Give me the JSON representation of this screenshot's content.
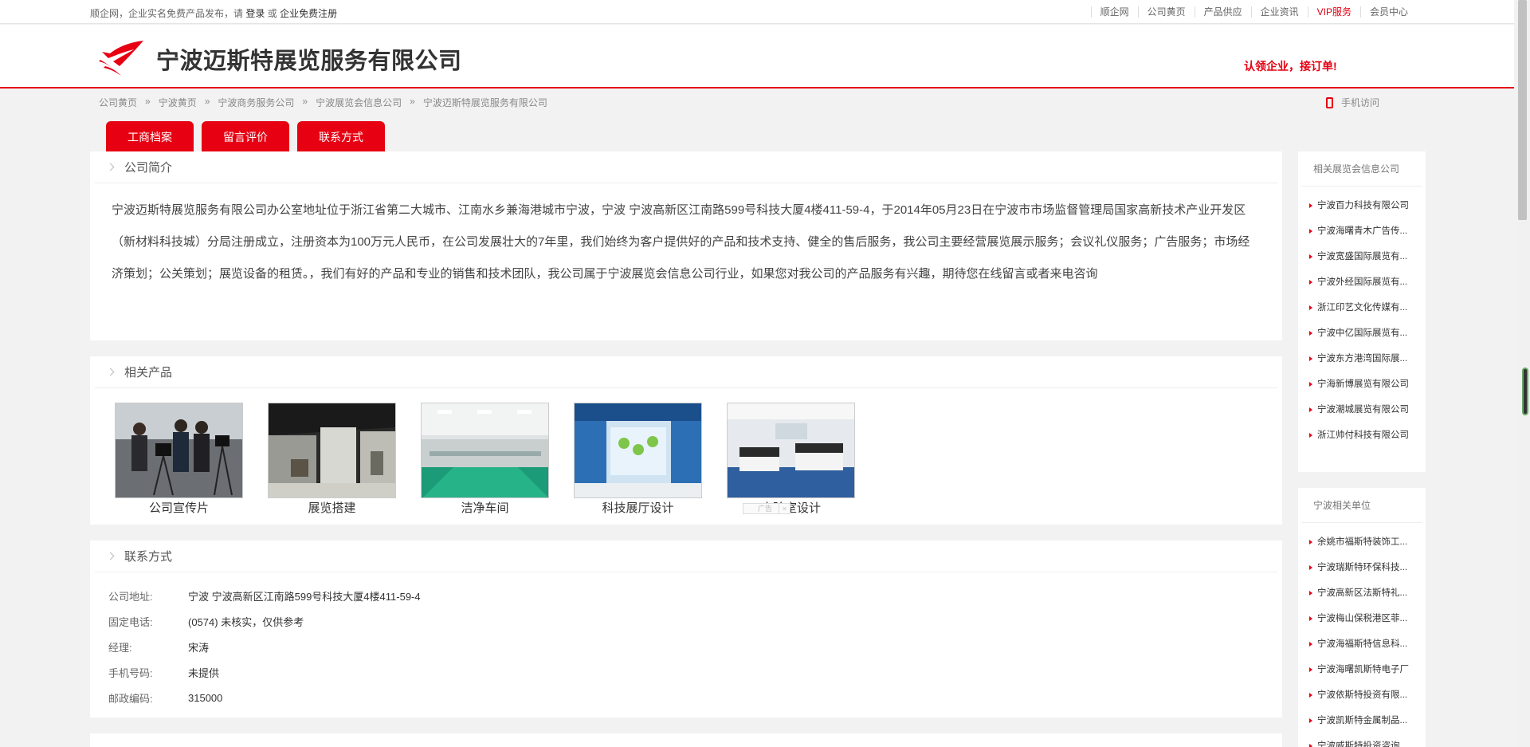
{
  "topbar": {
    "notice_prefix": "顺企网，企业实名免费产品发布，请",
    "login": "登录",
    "or": "或",
    "register": "企业免费注册",
    "links": [
      "顺企网",
      "公司黄页",
      "产品供应",
      "企业资讯",
      "VIP服务",
      "会员中心"
    ]
  },
  "header": {
    "company_name": "宁波迈斯特展览服务有限公司",
    "claim_text": "认领企业，接订单!",
    "brand_color": "#e60012"
  },
  "breadcrumb": [
    "公司黄页",
    "宁波黄页",
    "宁波商务服务公司",
    "宁波展览会信息公司",
    "宁波迈斯特展览服务有限公司"
  ],
  "breadcrumb_sep": "»",
  "mobile_link": "手机访问",
  "tabs": [
    "工商档案",
    "留言评价",
    "联系方式"
  ],
  "intro": {
    "title": "公司简介",
    "text": "宁波迈斯特展览服务有限公司办公室地址位于浙江省第二大城市、江南水乡兼海港城市宁波，宁波 宁波高新区江南路599号科技大厦4楼411-59-4，于2014年05月23日在宁波市市场监督管理局国家高新技术产业开发区（新材料科技城）分局注册成立，注册资本为100万元人民币，在公司发展壮大的7年里，我们始终为客户提供好的产品和技术支持、健全的售后服务，我公司主要经营展览展示服务；会议礼仪服务；广告服务；市场经济策划；公关策划；展览设备的租赁。，我们有好的产品和专业的销售和技术团队，我公司属于宁波展览会信息公司行业，如果您对我公司的产品服务有兴趣，期待您在线留言或者来电咨询"
  },
  "products": {
    "title": "相关产品",
    "items": [
      {
        "caption": "公司宣传片",
        "icon": "film-crew-photo"
      },
      {
        "caption": "展览搭建",
        "icon": "exhibition-hall-photo"
      },
      {
        "caption": "洁净车间",
        "icon": "clean-room-photo"
      },
      {
        "caption": "科技展厅设计",
        "icon": "tech-hall-photo"
      },
      {
        "caption": "实验室设计",
        "icon": "laboratory-photo"
      }
    ],
    "ad_label": "广告",
    "ad_close": "×"
  },
  "contact": {
    "title": "联系方式",
    "rows": [
      {
        "label": "公司地址:",
        "value": "宁波 宁波高新区江南路599号科技大厦4楼411-59-4"
      },
      {
        "label": "固定电话:",
        "value": "(0574) 未核实，仅供参考"
      },
      {
        "label": "经理:",
        "value": "宋涛"
      },
      {
        "label": "手机号码:",
        "value": "未提供"
      },
      {
        "label": "邮政编码:",
        "value": "315000"
      }
    ]
  },
  "sidebar_related": {
    "title": "相关展览会信息公司",
    "items": [
      "宁波百力科技有限公司",
      "宁波海曙青木广告传...",
      "宁波宽盛国际展览有...",
      "宁波外经国际展览有...",
      "浙江印艺文化传媒有...",
      "宁波中亿国际展览有...",
      "宁波东方港湾国际展...",
      "宁海新博展览有限公司",
      "宁波潮城展览有限公司",
      "浙江帅付科技有限公司"
    ]
  },
  "sidebar_units": {
    "title": "宁波相关单位",
    "items": [
      "余姚市福斯特装饰工...",
      "宁波瑞斯特环保科技...",
      "宁波高新区法斯特礼...",
      "宁波梅山保税港区菲...",
      "宁波海福斯特信息科...",
      "宁波海曙凯斯特电子厂",
      "宁波依斯特投资有限...",
      "宁波凯斯特金属制品...",
      "宁波威斯特投资咨询..."
    ]
  }
}
